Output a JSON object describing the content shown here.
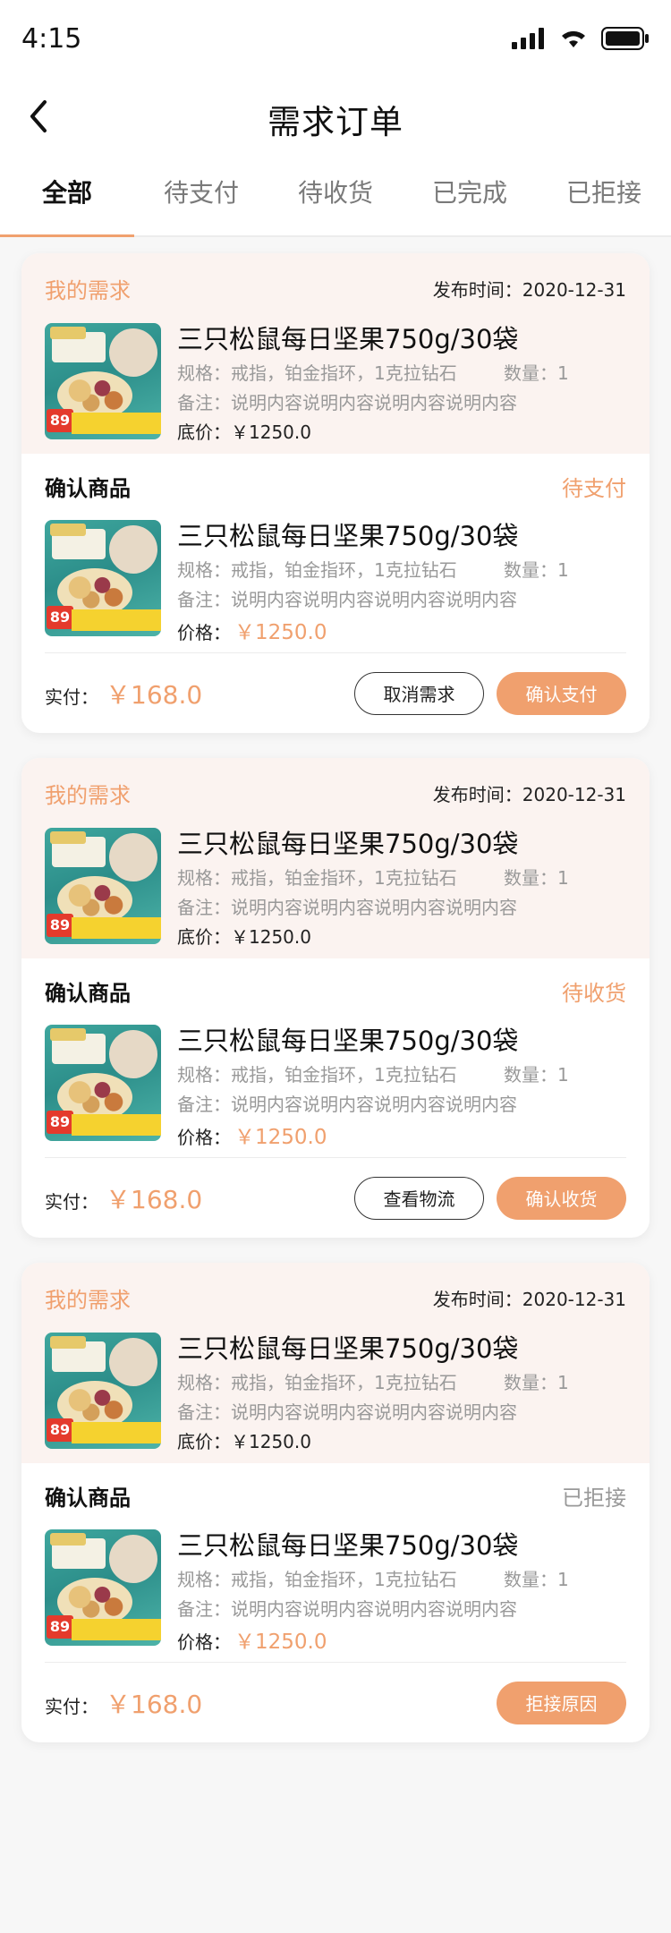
{
  "status_bar": {
    "time": "4:15"
  },
  "nav": {
    "title": "需求订单"
  },
  "tabs": [
    {
      "label": "全部",
      "active": true
    },
    {
      "label": "待支付",
      "active": false
    },
    {
      "label": "待收货",
      "active": false
    },
    {
      "label": "已完成",
      "active": false
    },
    {
      "label": "已拒接",
      "active": false
    }
  ],
  "colors": {
    "accent": "#f0a06e",
    "req_bg": "#fbf3f0",
    "muted": "#999999"
  },
  "orders": [
    {
      "req_title": "我的需求",
      "publish_time": "发布时间：2020-12-31",
      "req_product": {
        "name": "三只松鼠每日坚果750g/30袋",
        "spec": "规格：戒指，铂金指环，1克拉钻石",
        "qty": "数量：1",
        "note": "备注：说明内容说明内容说明内容说明内容",
        "base_price": "底价：￥1250.0"
      },
      "confirm_title": "确认商品",
      "status": "待支付",
      "confirm_product": {
        "name": "三只松鼠每日坚果750g/30袋",
        "spec": "规格：戒指，铂金指环，1克拉钻石",
        "qty": "数量：1",
        "note": "备注：说明内容说明内容说明内容说明内容",
        "price_label": "价格：",
        "price": "￥1250.0"
      },
      "paid_label": "实付：",
      "paid_amount": "￥168.0",
      "buttons": {
        "outline": "取消需求",
        "fill": "确认支付"
      }
    },
    {
      "req_title": "我的需求",
      "publish_time": "发布时间：2020-12-31",
      "req_product": {
        "name": "三只松鼠每日坚果750g/30袋",
        "spec": "规格：戒指，铂金指环，1克拉钻石",
        "qty": "数量：1",
        "note": "备注：说明内容说明内容说明内容说明内容",
        "base_price": "底价：￥1250.0"
      },
      "confirm_title": "确认商品",
      "status": "待收货",
      "confirm_product": {
        "name": "三只松鼠每日坚果750g/30袋",
        "spec": "规格：戒指，铂金指环，1克拉钻石",
        "qty": "数量：1",
        "note": "备注：说明内容说明内容说明内容说明内容",
        "price_label": "价格：",
        "price": "￥1250.0"
      },
      "paid_label": "实付：",
      "paid_amount": "￥168.0",
      "buttons": {
        "outline": "查看物流",
        "fill": "确认收货"
      }
    },
    {
      "req_title": "我的需求",
      "publish_time": "发布时间：2020-12-31",
      "req_product": {
        "name": "三只松鼠每日坚果750g/30袋",
        "spec": "规格：戒指，铂金指环，1克拉钻石",
        "qty": "数量：1",
        "note": "备注：说明内容说明内容说明内容说明内容",
        "base_price": "底价：￥1250.0"
      },
      "confirm_title": "确认商品",
      "status": "已拒接",
      "confirm_product": {
        "name": "三只松鼠每日坚果750g/30袋",
        "spec": "规格：戒指，铂金指环，1克拉钻石",
        "qty": "数量：1",
        "note": "备注：说明内容说明内容说明内容说明内容",
        "price_label": "价格：",
        "price": "￥1250.0"
      },
      "paid_label": "实付：",
      "paid_amount": "￥168.0",
      "buttons": {
        "fill": "拒接原因"
      }
    }
  ]
}
